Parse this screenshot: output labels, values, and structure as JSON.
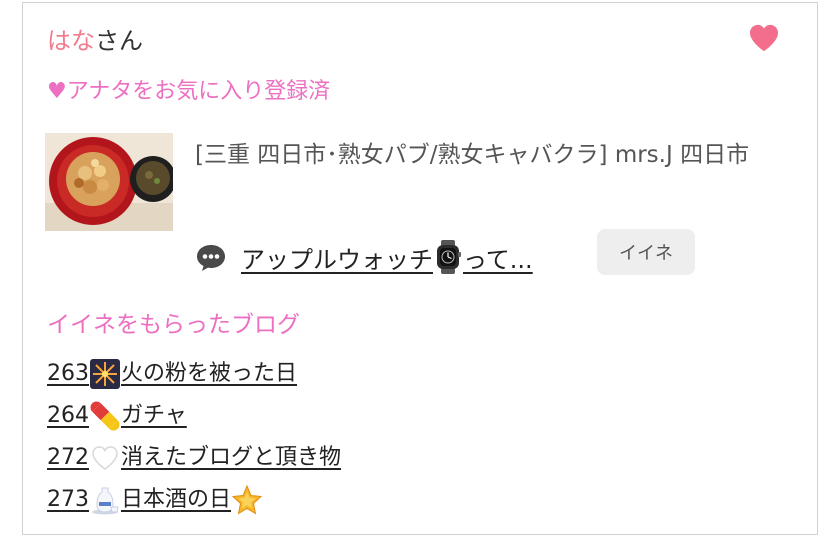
{
  "user": {
    "name": "はな",
    "suffix": "さん"
  },
  "favorite": {
    "status": "♥アナタをお気に入り登録済",
    "heart_color": "#f26e8c"
  },
  "entry": {
    "title": "[三重 四日市･熟女パブ/熟女キャバクラ]  mrs.J 四日市",
    "comment_text_before": "アップルウォッチ",
    "comment_text_after": "って...",
    "like_label": "イイネ",
    "thumbnail_icon": "food-bowl-photo",
    "comment_icon": "speech-bubble-icon",
    "watch_icon": "apple-watch-icon"
  },
  "liked_blogs": {
    "heading": "イイネをもらったブログ",
    "items": [
      {
        "number": "263",
        "icon": "fireworks-icon",
        "title": "火の粉を被った日",
        "trailing_icon": ""
      },
      {
        "number": "264",
        "icon": "pill-icon",
        "title": "ガチャ",
        "trailing_icon": ""
      },
      {
        "number": "272",
        "icon": "white-heart-icon",
        "title": "消えたブログと頂き物",
        "trailing_icon": ""
      },
      {
        "number": "273",
        "icon": "sake-icon",
        "title": "日本酒の日",
        "trailing_icon": "glowing-star-icon"
      }
    ]
  },
  "colors": {
    "name_pink": "#f07c8e",
    "accent_pink": "#ec6fc2",
    "button_gray": "#eeeeee"
  }
}
